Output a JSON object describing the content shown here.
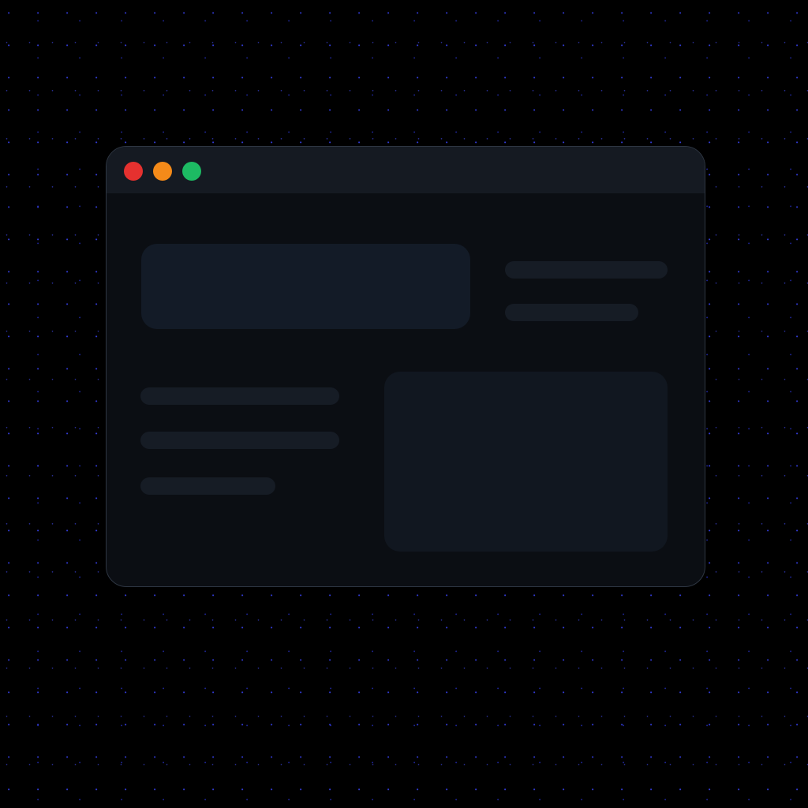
{
  "window": {
    "controls": [
      {
        "name": "close",
        "color": "#e5312f"
      },
      {
        "name": "minimize",
        "color": "#f48a19"
      },
      {
        "name": "zoom",
        "color": "#1dba63"
      }
    ]
  },
  "content": {
    "placeholders": [
      "hero-card",
      "text-bar",
      "text-bar",
      "text-bar",
      "text-bar",
      "text-bar",
      "media-card"
    ]
  },
  "theme": {
    "background": "#000000",
    "window": "#0b0e13",
    "titlebar": "#151a22",
    "card": "#131b27",
    "star": "#3c46ff"
  }
}
